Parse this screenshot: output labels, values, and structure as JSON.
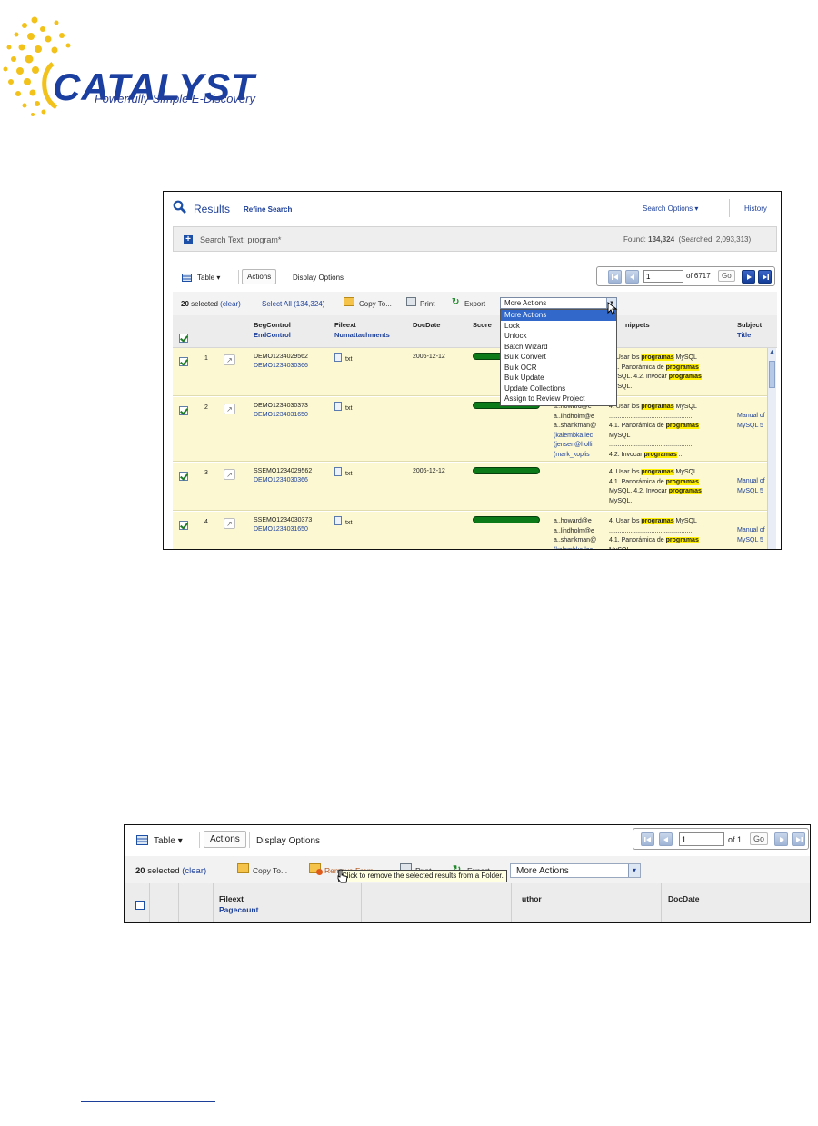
{
  "logo": {
    "wordmark": "CATALYST",
    "tagline": "Powerfully Simple E-Discovery",
    "colors": {
      "word": "#1b3fa0",
      "rays": "#f2c21a"
    }
  },
  "screenshot1": {
    "header": {
      "title": "Results",
      "refine_link": "Refine Search",
      "search_options": "Search Options",
      "history": "History"
    },
    "search_bar": {
      "label": "Search Text:",
      "query": "program*",
      "found_label": "Found:",
      "found_count": "134,324",
      "searched": "(Searched: 2,093,313)"
    },
    "toolbar": {
      "view": "Table",
      "actions_tab": "Actions",
      "display_options": "Display Options",
      "page_value": "1",
      "page_total": "of 6717",
      "go": "Go"
    },
    "action_bar": {
      "selected_count": "20",
      "selected_label": "selected",
      "clear": "(clear)",
      "select_all": "Select All (134,324)",
      "copy_to": "Copy To...",
      "print": "Print",
      "export": "Export",
      "more_actions": "More Actions"
    },
    "more_actions_menu": [
      "More Actions",
      "Lock",
      "Unlock",
      "Batch Wizard",
      "Bulk Convert",
      "Bulk OCR",
      "Bulk Update",
      "Update Collections",
      "Assign to Review Project"
    ],
    "columns": {
      "begcontrol": "BegControl",
      "endcontrol": "EndControl",
      "fileext": "Fileext",
      "numattachments": "Numattachments",
      "docdate": "DocDate",
      "score": "Score",
      "snippets": "Snippets",
      "snippets_visible": "nippets",
      "subject": "Subject",
      "title": "Title"
    },
    "rows": [
      {
        "num": "1",
        "beg": "DEMO1234029562",
        "end": "DEMO1234030366",
        "ext": "txt",
        "date": "2006-12-12",
        "people": [],
        "snippet": [
          {
            "pre": "4. Usar los ",
            "hl": "programas",
            "post": " MySQL"
          },
          {
            "pre": "4.1. Panorámica de ",
            "hl": "programas",
            "post": ""
          },
          {
            "pre": "MySQL. 4.2. Invocar ",
            "hl": "programas",
            "post": ""
          },
          {
            "pre": "MySQL.",
            "hl": "",
            "post": ""
          }
        ],
        "subject": []
      },
      {
        "num": "2",
        "beg": "DEMO1234030373",
        "end": "DEMO1234031650",
        "ext": "txt",
        "date": "",
        "people": [
          "a..howard@e",
          "a..lindholm@e",
          "a..shankman@",
          "(kalembka.lec",
          "(jensen@holli",
          "(mark_koplis"
        ],
        "snippet": [
          {
            "pre": "4. Usar los ",
            "hl": "programas",
            "post": " MySQL"
          },
          {
            "pre": "...............................................",
            "hl": "",
            "post": ""
          },
          {
            "pre": "4.1. Panorámica de ",
            "hl": "programas",
            "post": ""
          },
          {
            "pre": "MySQL",
            "hl": "",
            "post": ""
          },
          {
            "pre": "...............................................",
            "hl": "",
            "post": ""
          },
          {
            "pre": "4.2. Invocar ",
            "hl": "programas",
            "post": " ..."
          }
        ],
        "subject": [
          "Manual of",
          "MySQL 5"
        ]
      },
      {
        "num": "3",
        "beg": "SSEMO1234029562",
        "end": "DEMO1234030366",
        "ext": "txt",
        "date": "2006-12-12",
        "people": [],
        "snippet": [
          {
            "pre": "4. Usar los ",
            "hl": "programas",
            "post": " MySQL"
          },
          {
            "pre": "4.1. Panorámica de ",
            "hl": "programas",
            "post": ""
          },
          {
            "pre": "MySQL. 4.2. Invocar ",
            "hl": "programas",
            "post": ""
          },
          {
            "pre": "MySQL.",
            "hl": "",
            "post": ""
          }
        ],
        "subject": [
          "Manual of",
          "MySQL 5"
        ]
      },
      {
        "num": "4",
        "beg": "SSEMO1234030373",
        "end": "DEMO1234031650",
        "ext": "txt",
        "date": "",
        "people": [
          "a..howard@e",
          "a..lindholm@e",
          "a..shankman@",
          "(kalembka.lec"
        ],
        "snippet": [
          {
            "pre": "4. Usar los ",
            "hl": "programas",
            "post": " MySQL"
          },
          {
            "pre": "...............................................",
            "hl": "",
            "post": ""
          },
          {
            "pre": "4.1. Panorámica de ",
            "hl": "programas",
            "post": ""
          },
          {
            "pre": "MySQL",
            "hl": "",
            "post": ""
          }
        ],
        "subject": [
          "Manual of",
          "MySQL 5"
        ]
      }
    ]
  },
  "screenshot2": {
    "toolbar": {
      "view": "Table",
      "actions_tab": "Actions",
      "display_options": "Display Options",
      "page_value": "1",
      "page_total": "of 1",
      "go": "Go"
    },
    "action_bar": {
      "selected_count": "20",
      "selected_label": "selected",
      "clear": "(clear)",
      "copy_to": "Copy To...",
      "remove_from": "Remove From...",
      "print": "Print",
      "export": "Export",
      "more_actions": "More Actions"
    },
    "tooltip": "Click to remove the selected results from a Folder.",
    "columns": {
      "fileext": "Fileext",
      "pagecount": "Pagecount",
      "author": "Author",
      "author_visible": "uthor",
      "docdate": "DocDate"
    }
  }
}
